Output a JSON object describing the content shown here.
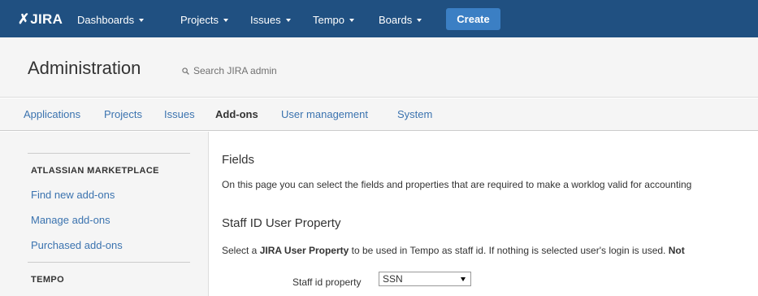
{
  "app": {
    "logo_mark": "✗",
    "logo_text": "JIRA"
  },
  "topnav": {
    "items": [
      {
        "label": "Dashboards",
        "has_dropdown": true
      },
      {
        "label": "Projects",
        "has_dropdown": true
      },
      {
        "label": "Issues",
        "has_dropdown": true
      },
      {
        "label": "Tempo",
        "has_dropdown": true
      },
      {
        "label": "Boards",
        "has_dropdown": true
      }
    ],
    "create_label": "Create"
  },
  "admin": {
    "title": "Administration",
    "search_placeholder": "Search JIRA admin"
  },
  "tabs": [
    {
      "label": "Applications",
      "active": false
    },
    {
      "label": "Projects",
      "active": false
    },
    {
      "label": "Issues",
      "active": false
    },
    {
      "label": "Add-ons",
      "active": true
    },
    {
      "label": "User management",
      "active": false
    },
    {
      "label": "System",
      "active": false
    }
  ],
  "sidebar": {
    "section1_heading": "ATLASSIAN MARKETPLACE",
    "links": [
      {
        "label": "Find new add-ons"
      },
      {
        "label": "Manage add-ons"
      },
      {
        "label": "Purchased add-ons"
      }
    ],
    "section2_heading": "TEMPO"
  },
  "main": {
    "fields_heading": "Fields",
    "fields_description": "On this page you can select the fields and properties that are required to make a worklog valid for accounting",
    "staff_heading": "Staff ID User Property",
    "staff_desc_pre": "Select a ",
    "staff_desc_bold": "JIRA User Property",
    "staff_desc_post": " to be used in Tempo as staff id. If nothing is selected user's login is used. ",
    "staff_desc_trail": "Not",
    "staff_field_label": "Staff id property",
    "staff_field_value": "SSN"
  },
  "colors": {
    "topbar": "#205081",
    "create_button": "#3b7fc4",
    "link": "#3b73af",
    "panel_background": "#f5f5f5"
  }
}
